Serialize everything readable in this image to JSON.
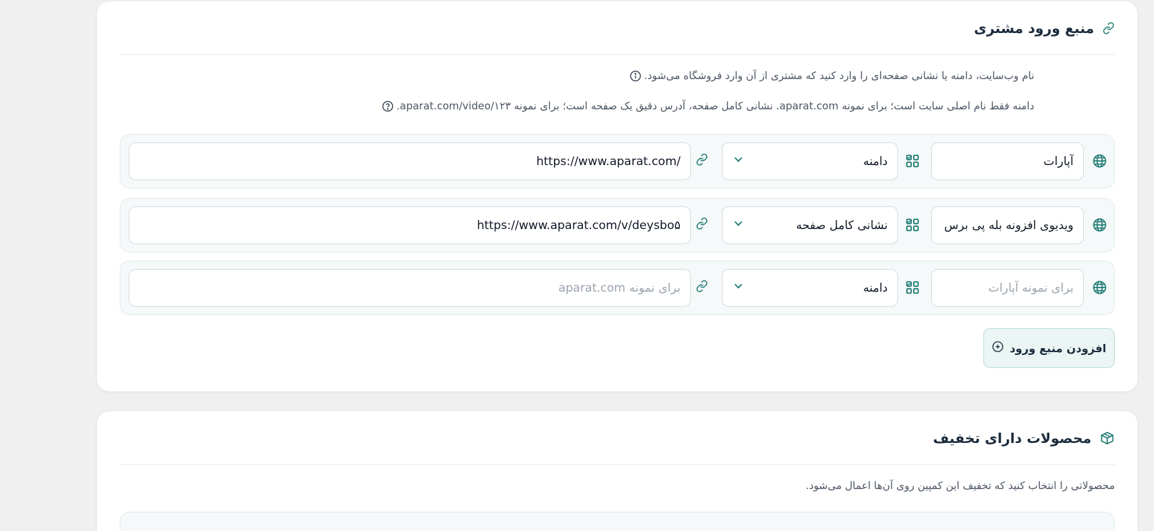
{
  "source_section": {
    "title": "منبع ورود مشتری",
    "info_text": "نام وب‌سایت، دامنه یا نشانی صفحه‌ای را وارد کنید که مشتری از آن وارد فروشگاه می‌شود.",
    "help_text": "دامنه فقط نام اصلی سایت است؛ برای نمونه aparat.com. نشانی کامل صفحه، آدرس دقیق یک صفحه است؛ برای نمونه aparat.com/video/۱۲۳.",
    "rows": [
      {
        "name": "آپارات",
        "type": "دامنه",
        "url": "https://www.aparat.com/"
      },
      {
        "name": "ویدیوی افزونه بله پی برس",
        "type": "نشانی کامل صفحه",
        "url": "https://www.aparat.com/v/deysbo۵"
      },
      {
        "name_placeholder": "برای نمونه آپارات",
        "type": "دامنه",
        "url_placeholder": "برای نمونه aparat.com"
      }
    ],
    "add_button": "افزودن منبع ورود"
  },
  "products_section": {
    "title": "محصولات دارای تخفیف",
    "description": "محصولاتی را انتخاب کنید که تخفیف این کمپین روی آن‌ها اعمال می‌شود."
  },
  "colors": {
    "accent": "#1f7a73",
    "title": "#1a2b3c",
    "background": "#f0f0f0"
  },
  "icons": {
    "header1": "link-icon",
    "header2": "box-icon",
    "row_prefix": "globe-icon",
    "type_indicator": "grid-icon",
    "url_indicator": "link-icon",
    "add": "plus-circle-icon"
  }
}
